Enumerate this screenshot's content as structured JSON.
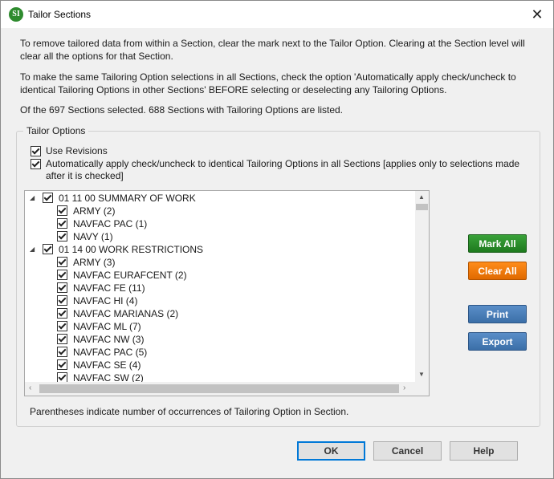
{
  "window": {
    "title": "Tailor Sections",
    "icon_text": "SI",
    "close_glyph": "✕"
  },
  "instructions": [
    "To remove tailored data from within a Section, clear the mark next to the Tailor Option. Clearing at the Section level will clear all the options for that Section.",
    "To make the same Tailoring Option selections in all Sections, check the option 'Automatically apply check/uncheck to identical Tailoring Options in other Sections' BEFORE selecting or deselecting any Tailoring Options.",
    "Of the 697 Sections selected.  688 Sections with Tailoring Options are listed."
  ],
  "tailor_options": {
    "group_label": "Tailor Options",
    "use_revisions": {
      "label": "Use Revisions",
      "checked": true
    },
    "auto_apply": {
      "label_line1": "Automatically apply check/uncheck to identical Tailoring Options in all Sections [applies only to selections made",
      "label_line2": "after it is checked]",
      "checked": true
    }
  },
  "tree": {
    "sections": [
      {
        "label": "01 11 00  SUMMARY OF WORK",
        "expanded": true,
        "checked": true,
        "options": [
          "ARMY  (2)",
          "NAVFAC PAC  (1)",
          "NAVY  (1)"
        ]
      },
      {
        "label": "01 14 00  WORK RESTRICTIONS",
        "expanded": true,
        "checked": true,
        "options": [
          "ARMY  (3)",
          "NAVFAC EURAFCENT  (2)",
          "NAVFAC FE  (11)",
          "NAVFAC HI  (4)",
          "NAVFAC MARIANAS  (2)",
          "NAVFAC ML  (7)",
          "NAVFAC NW  (3)",
          "NAVFAC PAC  (5)",
          "NAVFAC SE  (4)",
          "NAVFAC SW  (2)"
        ]
      }
    ]
  },
  "side_buttons": {
    "mark_all": "Mark All",
    "clear_all": "Clear All",
    "print": "Print",
    "export": "Export"
  },
  "footnote": "Parentheses indicate number of occurrences of Tailoring Option in Section.",
  "dialog_buttons": {
    "ok": "OK",
    "cancel": "Cancel",
    "help": "Help"
  },
  "colors": {
    "mark_all": "#2a8f2a",
    "clear_all": "#f07d0d",
    "print": "#4a7fbb",
    "export": "#4a7fbb"
  }
}
